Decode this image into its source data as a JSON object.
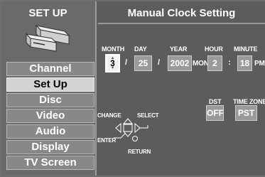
{
  "sidebar": {
    "title": "SET UP",
    "items": [
      {
        "label": "Channel"
      },
      {
        "label": "Set Up"
      },
      {
        "label": "Disc"
      },
      {
        "label": "Video"
      },
      {
        "label": "Audio"
      },
      {
        "label": "Display"
      },
      {
        "label": "TV Screen"
      }
    ],
    "selected": "Set Up",
    "logo_icon": "dvd-vcr-device-icon"
  },
  "clock": {
    "title": "Manual Clock Setting",
    "month_label": "MONTH",
    "day_label": "DAY",
    "year_label": "YEAR",
    "hour_label": "HOUR",
    "minute_label": "MINUTE",
    "month": "3",
    "day": "25",
    "year": "2002",
    "weekday": "MON",
    "hour": "2",
    "minute": "18",
    "ampm": "PM",
    "date_sep": "/",
    "time_sep": ":",
    "dst_label": "DST",
    "dst": "OFF",
    "timezone_label": "TIME ZONE",
    "timezone": "PST"
  },
  "nav": {
    "change_label": "CHANGE",
    "select_label": "SELECT",
    "enter_label": "ENTER",
    "return_label": "RETURN",
    "icon": "dpad-arrows-icon"
  },
  "colors": {
    "background": "#6f6f6f",
    "menu_item": "#888888",
    "menu_selected": "#d4d4d4",
    "field": "#9a9a9a",
    "field_active": "#f2f2f2"
  }
}
